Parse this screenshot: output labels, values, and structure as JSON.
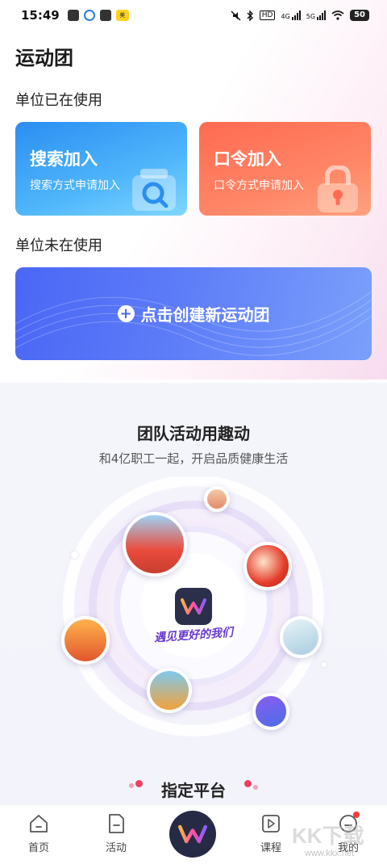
{
  "status_bar": {
    "time": "15:49",
    "network_badge": "HD",
    "signal_4g": "4G",
    "signal_5g": "5G",
    "battery": "50"
  },
  "page": {
    "title": "运动团",
    "section_in_use": "单位已在使用",
    "section_not_in_use": "单位未在使用"
  },
  "cards": {
    "search": {
      "title": "搜索加入",
      "subtitle": "搜索方式申请加入",
      "icon": "search-icon"
    },
    "code": {
      "title": "口令加入",
      "subtitle": "口令方式申请加入",
      "icon": "lock-icon"
    }
  },
  "create": {
    "label": "点击创建新运动团",
    "icon": "plus-circle-icon"
  },
  "promo": {
    "title": "团队活动用趣动",
    "subtitle": "和4亿职工一起，开启品质健康生活",
    "slogan": "遇见更好的我们",
    "platform": "指定平台"
  },
  "tabs": [
    {
      "label": "首页",
      "icon": "home-icon"
    },
    {
      "label": "活动",
      "icon": "document-icon"
    },
    {
      "label": "",
      "icon": "app-logo-icon"
    },
    {
      "label": "课程",
      "icon": "video-icon"
    },
    {
      "label": "我的",
      "icon": "user-icon"
    }
  ],
  "watermark": {
    "main": "KK下载",
    "sub": "www.kkx.net"
  },
  "colors": {
    "search_card": "#2b8ef2",
    "code_card": "#ff6b52",
    "create_card": "#4a67f5",
    "logo_bg": "#2b2f4a",
    "badge": "#f23b3b"
  }
}
